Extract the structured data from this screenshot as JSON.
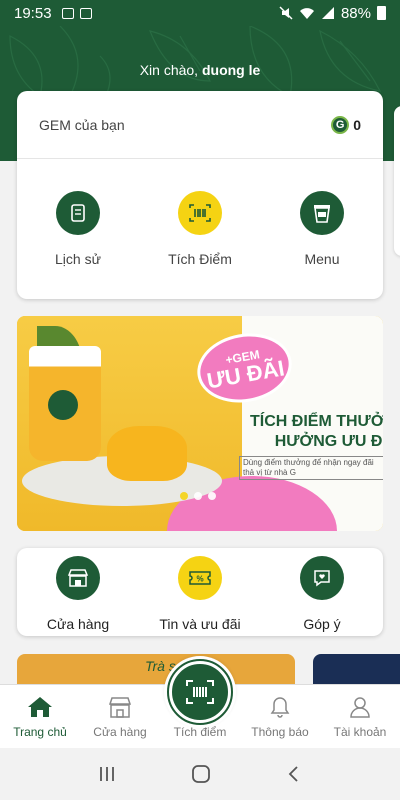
{
  "status_bar": {
    "time": "19:53",
    "battery": "88%",
    "icons_left": [
      "image-icon",
      "app-icon"
    ],
    "icons_right": [
      "mute-icon",
      "wifi-icon",
      "signal-icon",
      "battery-icon"
    ]
  },
  "header": {
    "greeting_prefix": "Xin chào,",
    "user_name": "duong le"
  },
  "gem": {
    "label": "GEM của bạn",
    "badge_letter": "G",
    "count": "0"
  },
  "quick_actions": [
    {
      "label": "Lịch sử",
      "icon": "scroll-icon"
    },
    {
      "label": "Tích Điểm",
      "icon": "barcode-icon"
    },
    {
      "label": "Menu",
      "icon": "coffee-cup-icon"
    }
  ],
  "banner": {
    "badge_small": "+GEM",
    "badge_big": "ƯU ĐÃI",
    "title_line1": "TÍCH ĐIỂM THƯỞ",
    "title_line2": "HƯỞNG ƯU Đ",
    "subtitle": "Dùng điểm thưởng để nhận ngay đãi thả vị từ nhà G",
    "slide_count": 3,
    "active_slide": 1
  },
  "services": [
    {
      "label": "Cửa hàng",
      "icon": "store-icon"
    },
    {
      "label": "Tin và ưu đãi",
      "icon": "coupon-icon"
    },
    {
      "label": "Góp ý",
      "icon": "feedback-icon"
    }
  ],
  "peek_card_text": "Trà s",
  "bottom_nav": [
    {
      "label": "Trang chủ",
      "icon": "home-icon",
      "active": true
    },
    {
      "label": "Cửa hàng",
      "icon": "store-icon",
      "active": false
    },
    {
      "label": "Tích điểm",
      "icon": "barcode-icon",
      "active": false
    },
    {
      "label": "Thông báo",
      "icon": "bell-icon",
      "active": false
    },
    {
      "label": "Tài khoản",
      "icon": "user-icon",
      "active": false
    }
  ],
  "colors": {
    "brand_green": "#1e5b36",
    "accent_yellow": "#f5d313",
    "promo_pink": "#f27bbf"
  }
}
